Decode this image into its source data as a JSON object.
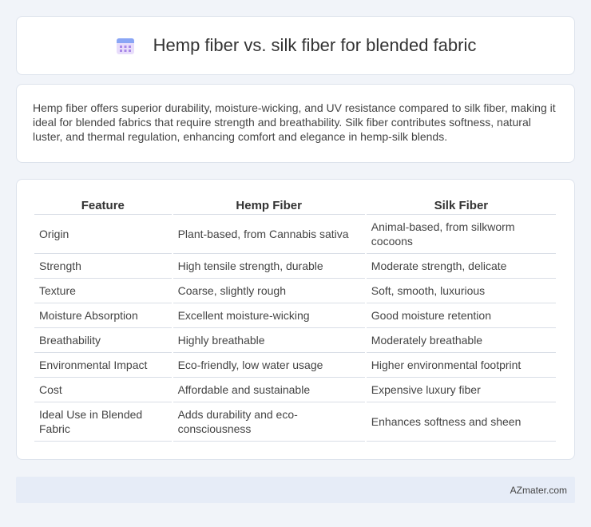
{
  "header": {
    "title": "Hemp fiber vs. silk fiber for blended fabric",
    "icon": "calendar-icon",
    "icon_colors": {
      "top": "#8aa6f5",
      "body": "#e8ddfb",
      "dots": "#a98ae8"
    }
  },
  "summary": {
    "text": "Hemp fiber offers superior durability, moisture-wicking, and UV resistance compared to silk fiber, making it ideal for blended fabrics that require strength and breathability. Silk fiber contributes softness, natural luster, and thermal regulation, enhancing comfort and elegance in hemp-silk blends."
  },
  "table": {
    "headers": [
      "Feature",
      "Hemp Fiber",
      "Silk Fiber"
    ],
    "rows": [
      [
        "Origin",
        "Plant-based, from Cannabis sativa",
        "Animal-based, from silkworm cocoons"
      ],
      [
        "Strength",
        "High tensile strength, durable",
        "Moderate strength, delicate"
      ],
      [
        "Texture",
        "Coarse, slightly rough",
        "Soft, smooth, luxurious"
      ],
      [
        "Moisture Absorption",
        "Excellent moisture-wicking",
        "Good moisture retention"
      ],
      [
        "Breathability",
        "Highly breathable",
        "Moderately breathable"
      ],
      [
        "Environmental Impact",
        "Eco-friendly, low water usage",
        "Higher environmental footprint"
      ],
      [
        "Cost",
        "Affordable and sustainable",
        "Expensive luxury fiber"
      ],
      [
        "Ideal Use in Blended Fabric",
        "Adds durability and eco-consciousness",
        "Enhances softness and sheen"
      ]
    ]
  },
  "footer": {
    "brand": "AZmater.com"
  }
}
